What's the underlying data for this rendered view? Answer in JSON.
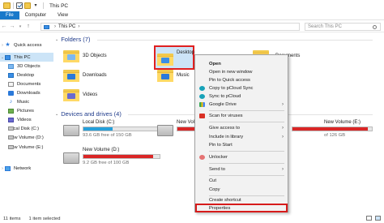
{
  "window": {
    "title": "This PC"
  },
  "ribbon": {
    "tabs": [
      "File",
      "Computer",
      "View"
    ]
  },
  "address": {
    "crumb": "This PC",
    "search_placeholder": "Search This PC"
  },
  "sidebar": {
    "items": [
      {
        "label": "Quick access",
        "icon": "star-icon"
      },
      {
        "label": "This PC",
        "icon": "computer-icon",
        "selected": true
      },
      {
        "label": "3D Objects",
        "icon": "cube-icon"
      },
      {
        "label": "Desktop",
        "icon": "desktop-icon"
      },
      {
        "label": "Documents",
        "icon": "documents-icon"
      },
      {
        "label": "Downloads",
        "icon": "downloads-icon"
      },
      {
        "label": "Music",
        "icon": "music-icon"
      },
      {
        "label": "Pictures",
        "icon": "pictures-icon"
      },
      {
        "label": "Videos",
        "icon": "videos-icon"
      },
      {
        "label": "Local Disk (C:)",
        "icon": "drive-icon"
      },
      {
        "label": "New Volume (D:)",
        "icon": "drive-icon"
      },
      {
        "label": "New Volume (E:)",
        "icon": "drive-icon"
      },
      {
        "label": "Network",
        "icon": "network-icon"
      }
    ]
  },
  "folders": {
    "header": "Folders (7)",
    "items": [
      "3D Objects",
      "Desktop",
      "Documents",
      "Downloads",
      "Music",
      "Videos"
    ]
  },
  "drives": {
    "header": "Devices and drives (4)",
    "items": [
      {
        "label": "Local Disk (C:)",
        "free": "93.6 GB free of 150 GB",
        "used": 0.38
      },
      {
        "label": "New Volume",
        "free": "",
        "used": 0.9
      },
      {
        "label": "New Volume (E:)",
        "free": "of 126 GB",
        "used": 0.95
      },
      {
        "label": "New Volume (D:)",
        "free": "9.2 GB free of 100 GB",
        "used": 0.91
      }
    ]
  },
  "context_menu": {
    "items": [
      "Open",
      "Open in new window",
      "Pin to Quick access",
      "Copy to pCloud Sync",
      "Sync to pCloud",
      "Google Drive",
      "Scan for viruses",
      "Give access to",
      "Include in library",
      "Pin to Start",
      "Unlocker",
      "Send to",
      "Cut",
      "Copy",
      "Create shortcut",
      "Properties"
    ]
  },
  "status": {
    "count": "11 items",
    "selected": "1 item selected"
  },
  "colors": {
    "accent": "#1979ca",
    "selection": "#cce4f7",
    "highlight": "#e02020",
    "bar": "#26a0da",
    "bar_full": "#da2626"
  }
}
